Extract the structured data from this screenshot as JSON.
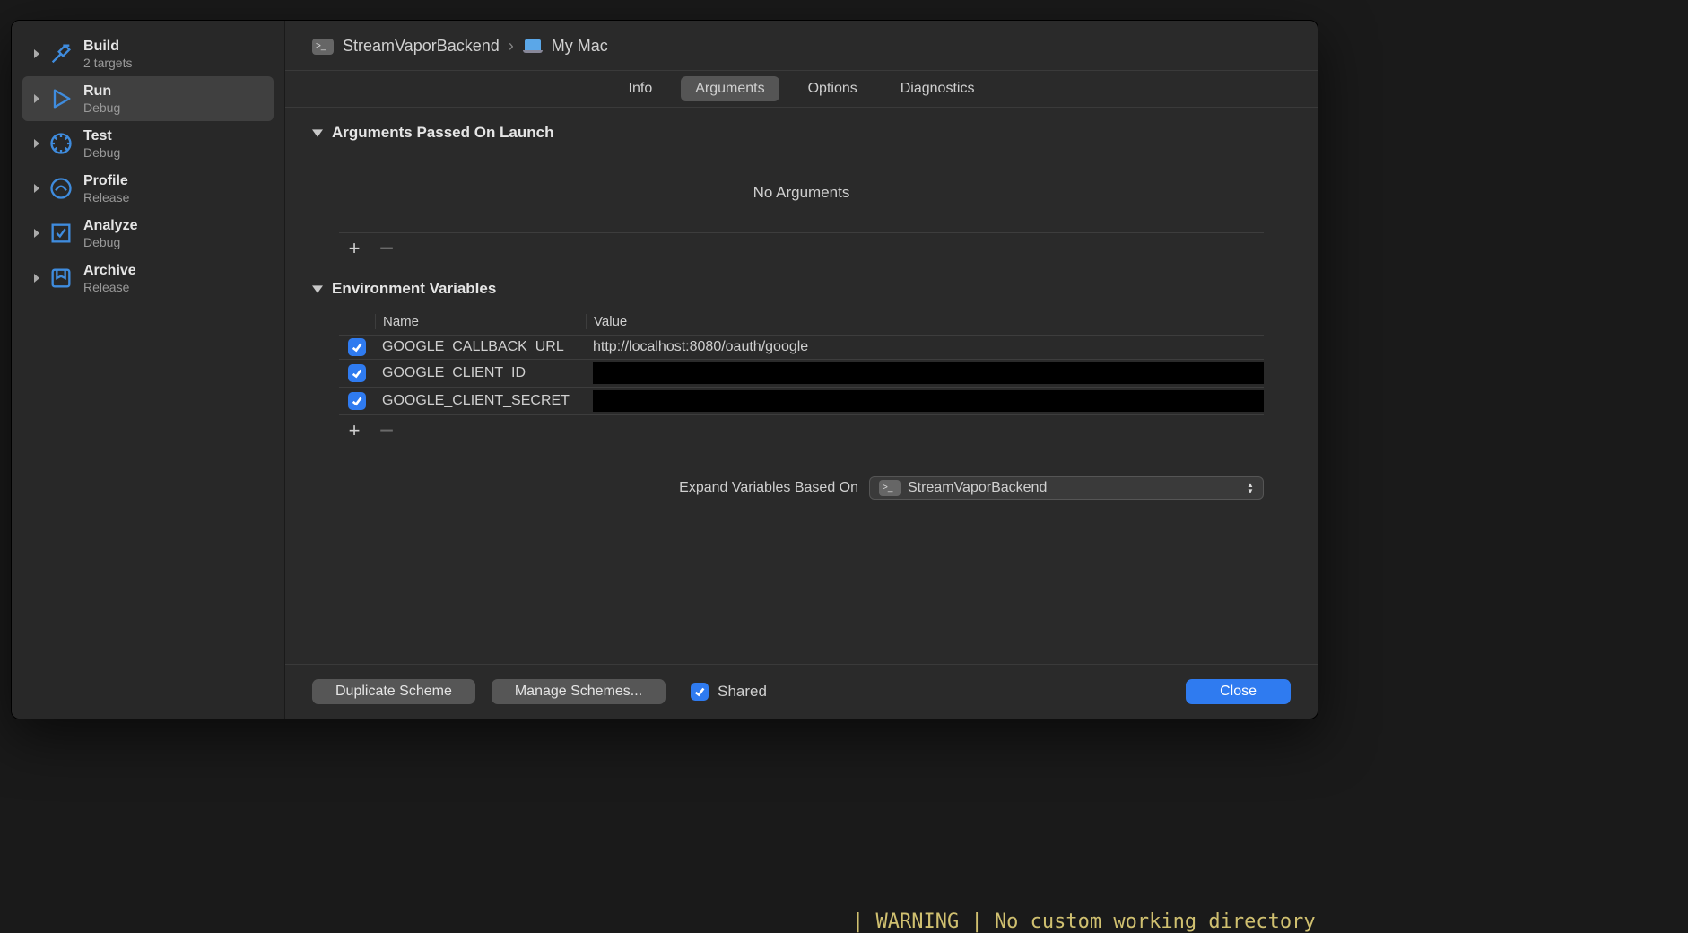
{
  "breadcrumb": {
    "project": "StreamVaporBackend",
    "destination": "My Mac"
  },
  "sidebar": {
    "items": [
      {
        "title": "Build",
        "sub": "2 targets",
        "selected": false,
        "icon": "hammer",
        "color": "#3f8cde"
      },
      {
        "title": "Run",
        "sub": "Debug",
        "selected": true,
        "icon": "play",
        "color": "#3f8cde"
      },
      {
        "title": "Test",
        "sub": "Debug",
        "selected": false,
        "icon": "wrench",
        "color": "#3f8cde"
      },
      {
        "title": "Profile",
        "sub": "Release",
        "selected": false,
        "icon": "gauge",
        "color": "#3f8cde"
      },
      {
        "title": "Analyze",
        "sub": "Debug",
        "selected": false,
        "icon": "analyze",
        "color": "#3f8cde"
      },
      {
        "title": "Archive",
        "sub": "Release",
        "selected": false,
        "icon": "archive",
        "color": "#3f8cde"
      }
    ]
  },
  "tabs": {
    "items": [
      "Info",
      "Arguments",
      "Options",
      "Diagnostics"
    ],
    "active": "Arguments"
  },
  "sections": {
    "args_title": "Arguments Passed On Launch",
    "args_empty": "No Arguments",
    "env_title": "Environment Variables",
    "env_headers": {
      "name": "Name",
      "value": "Value"
    },
    "env_rows": [
      {
        "name": "GOOGLE_CALLBACK_URL",
        "value": "http://localhost:8080/oauth/google",
        "redacted": false
      },
      {
        "name": "GOOGLE_CLIENT_ID",
        "value": "",
        "redacted": true
      },
      {
        "name": "GOOGLE_CLIENT_SECRET",
        "value": "",
        "redacted": true
      }
    ],
    "expand_label": "Expand Variables Based On",
    "expand_value": "StreamVaporBackend"
  },
  "footer": {
    "duplicate": "Duplicate Scheme",
    "manage": "Manage Schemes...",
    "shared": "Shared",
    "close": "Close"
  },
  "terminal_hint": "| WARNING | No custom working directory"
}
